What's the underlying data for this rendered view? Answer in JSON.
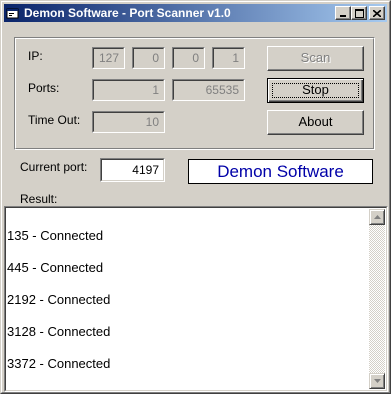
{
  "window": {
    "title": "Demon Software - Port Scanner v1.0"
  },
  "titlebar_buttons": {
    "minimize_icon": "minimize-icon",
    "maximize_icon": "maximize-icon",
    "close_icon": "close-icon"
  },
  "form": {
    "ip_label": "IP:",
    "ip": [
      "127",
      "0",
      "0",
      "1"
    ],
    "ports_label": "Ports:",
    "port_start": "1",
    "port_end": "65535",
    "timeout_label": "Time Out:",
    "timeout": "10"
  },
  "buttons": {
    "scan": "Scan",
    "stop": "Stop",
    "about": "About"
  },
  "status": {
    "current_port_label": "Current port:",
    "current_port": "4197",
    "brand": "Demon Software"
  },
  "result": {
    "label": "Result:",
    "lines": [
      "135 - Connected",
      "445 - Connected",
      "2192 - Connected",
      "3128 - Connected",
      "3372 - Connected"
    ]
  },
  "colors": {
    "titlebar_start": "#0a246a",
    "titlebar_end": "#a6caf0",
    "brand_text": "#0000a8",
    "face": "#d4d0c8"
  }
}
